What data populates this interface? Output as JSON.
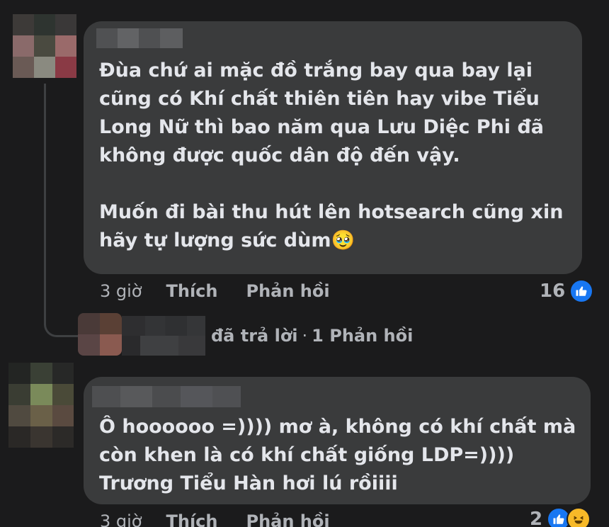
{
  "comment1": {
    "text_p1": "Đùa chứ ai mặc đồ trắng bay qua bay lại cũng có Khí chất thiên tiên hay vibe Tiểu Long Nữ thì bao năm qua Lưu Diệc Phi đã không được quốc dân độ đến vậy.",
    "text_p2": "Muốn đi bài thu hút lên hotsearch cũng xin hãy tự lượng sức dùm",
    "emoji": "🥹",
    "time": "3 giờ",
    "like_label": "Thích",
    "reply_label": "Phản hồi",
    "reaction_count": "16",
    "reaction_icon": "like-icon"
  },
  "reply_summary": {
    "text": "đã trả lời",
    "separator": "·",
    "replies": "1 Phản hồi"
  },
  "comment2": {
    "text": "Ô hoooooo =)))) mơ à, không có khí chất mà còn khen là có khí chất giống LDP=)))) Trương Tiểu Hàn hơi lú rồiiii",
    "time": "3 giờ",
    "like_label": "Thích",
    "reply_label": "Phản hồi",
    "reaction_count": "2",
    "reaction_icons": [
      "like-icon",
      "haha-icon"
    ]
  },
  "colors": {
    "background": "#1b1b1c",
    "bubble": "#3a3b3c",
    "text": "#e4e6eb",
    "secondary": "#b0b3b8",
    "like_blue": "#1877f2",
    "haha_yellow": "#f7b928"
  }
}
